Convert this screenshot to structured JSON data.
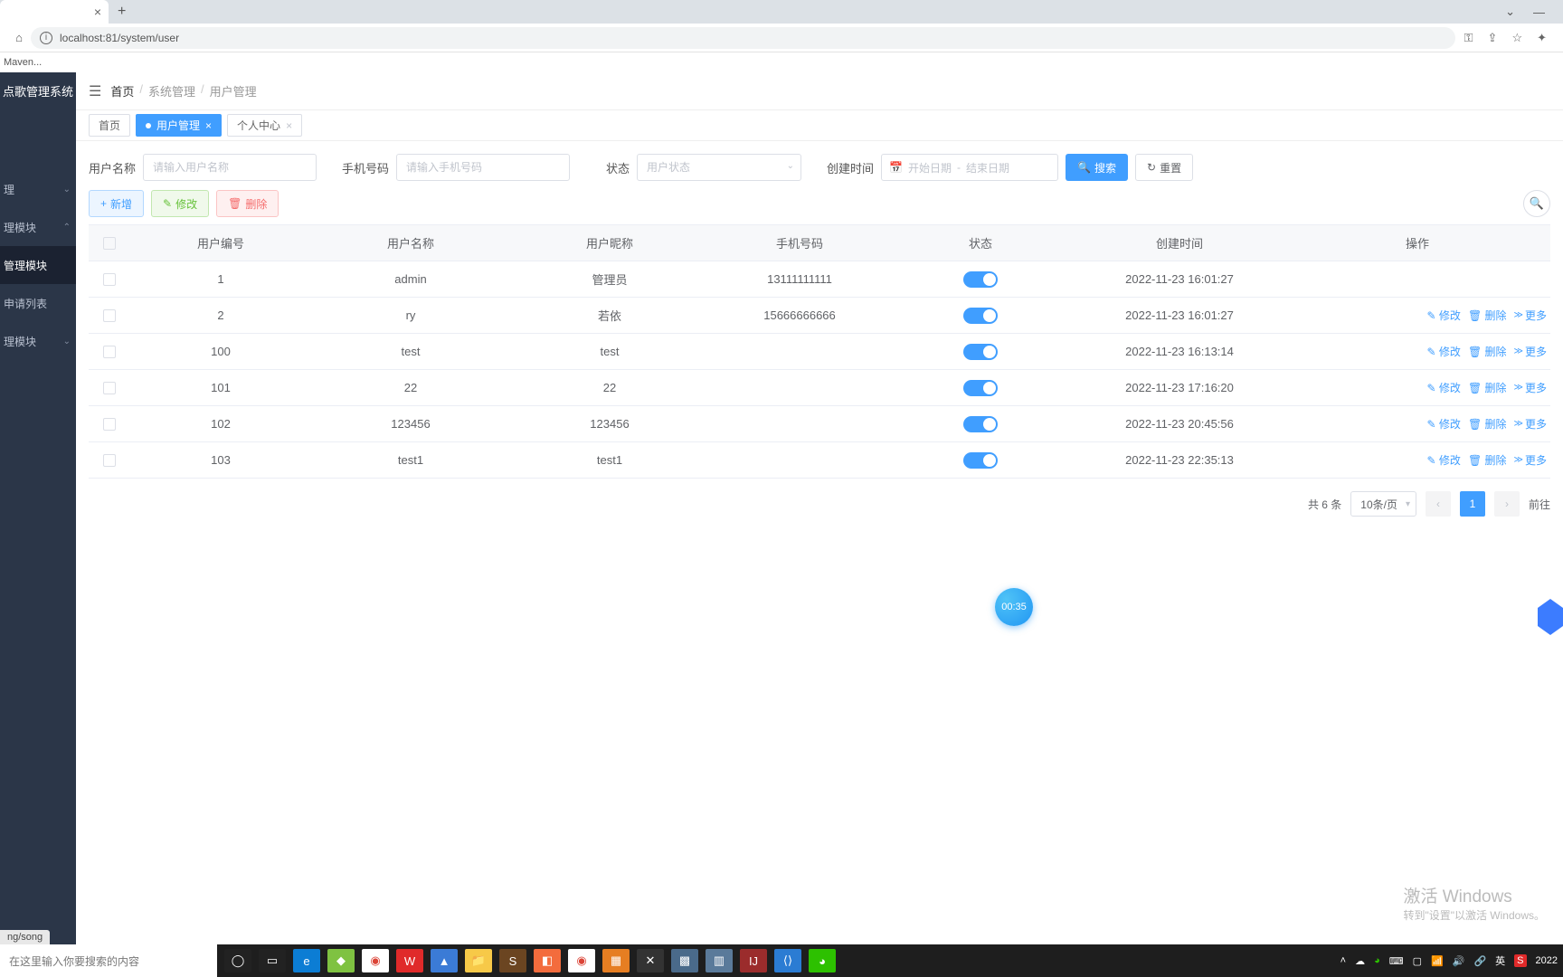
{
  "browser": {
    "url": "localhost:81/system/user",
    "bookmark": "Maven..."
  },
  "app": {
    "title": "点歌管理系统"
  },
  "sidebar": {
    "items": [
      {
        "label": "理",
        "chev": "⌄"
      },
      {
        "label": "理模块",
        "chev": "⌃"
      },
      {
        "label": "管理模块",
        "active": true
      },
      {
        "label": "申请列表"
      },
      {
        "label": "理模块",
        "chev": "⌄"
      }
    ]
  },
  "breadcrumbs": {
    "home": "首页",
    "b1": "系统管理",
    "b2": "用户管理"
  },
  "tabs": [
    {
      "label": "首页",
      "active": false,
      "closable": false
    },
    {
      "label": "用户管理",
      "active": true,
      "closable": true
    },
    {
      "label": "个人中心",
      "active": false,
      "closable": true
    }
  ],
  "filters": {
    "username_label": "用户名称",
    "username_ph": "请输入用户名称",
    "phone_label": "手机号码",
    "phone_ph": "请输入手机号码",
    "status_label": "状态",
    "status_ph": "用户状态",
    "created_label": "创建时间",
    "date_start_ph": "开始日期",
    "date_sep": "-",
    "date_end_ph": "结束日期",
    "search_btn": "搜索",
    "reset_btn": "重置"
  },
  "actions": {
    "add": "新增",
    "edit": "修改",
    "del": "删除"
  },
  "columns": {
    "id": "用户编号",
    "name": "用户名称",
    "nick": "用户昵称",
    "phone": "手机号码",
    "status": "状态",
    "time": "创建时间",
    "ops": "操作"
  },
  "rows": [
    {
      "id": "1",
      "name": "admin",
      "nick": "管理员",
      "phone": "13111111111",
      "time": "2022-11-23 16:01:27",
      "ops": false
    },
    {
      "id": "2",
      "name": "ry",
      "nick": "若依",
      "phone": "15666666666",
      "time": "2022-11-23 16:01:27",
      "ops": true
    },
    {
      "id": "100",
      "name": "test",
      "nick": "test",
      "phone": "",
      "time": "2022-11-23 16:13:14",
      "ops": true
    },
    {
      "id": "101",
      "name": "22",
      "nick": "22",
      "phone": "",
      "time": "2022-11-23 17:16:20",
      "ops": true
    },
    {
      "id": "102",
      "name": "123456",
      "nick": "123456",
      "phone": "",
      "time": "2022-11-23 20:45:56",
      "ops": true
    },
    {
      "id": "103",
      "name": "test1",
      "nick": "test1",
      "phone": "",
      "time": "2022-11-23 22:35:13",
      "ops": true
    }
  ],
  "row_ops": {
    "edit": "修改",
    "del": "删除",
    "more": "更多"
  },
  "pagination": {
    "total": "共 6 条",
    "size": "10条/页",
    "page": "1",
    "goto": "前往"
  },
  "float_time": "00:35",
  "win_activate": {
    "l1": "激活 Windows",
    "l2": "转到\"设置\"以激活 Windows。"
  },
  "status_hint": "ng/song",
  "taskbar": {
    "search_ph": "在这里输入你要搜索的内容",
    "lang": "英",
    "time": "2022"
  }
}
